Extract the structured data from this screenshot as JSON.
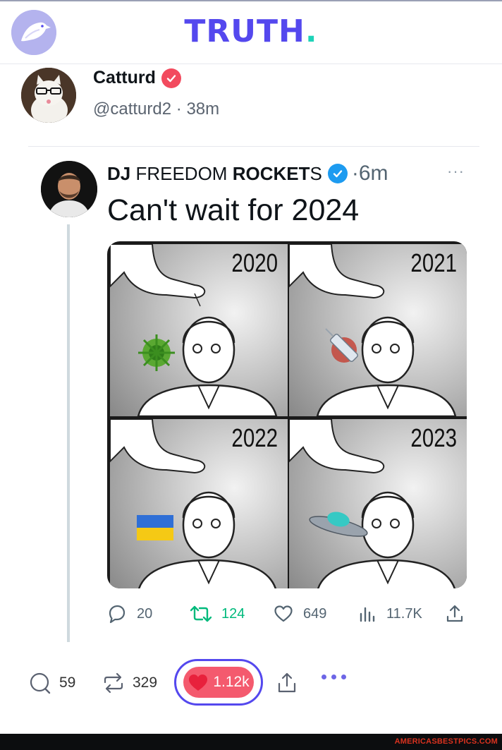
{
  "header": {
    "logo_text": "TRUTH",
    "logo_dot": ".",
    "brand_color": "#5448EE",
    "dot_color": "#1ED3B8"
  },
  "post": {
    "author_name": "Catturd",
    "verified_icon": "verified-badge-icon",
    "handle": "@catturd2",
    "separator": "·",
    "time": "38m",
    "actions": {
      "replies": "59",
      "retruths": "329",
      "likes": "1.12k"
    },
    "like_color": "#F45A6E"
  },
  "quoted": {
    "name_prefix": "DJ ",
    "name_middle": "FREEDOM ",
    "name_bold": "ROCKET",
    "name_suffix": "S",
    "separator": "·",
    "time": "6m",
    "more": "···",
    "text": "Can't wait for 2024",
    "meme_years": [
      "2020",
      "2021",
      "2022",
      "2023"
    ],
    "actions": {
      "replies": "20",
      "retweets": "124",
      "likes": "649",
      "views": "11.7K"
    },
    "verified_color": "#1D9BF0"
  },
  "footer": {
    "watermark": "AMERICASBESTPICS.COM"
  }
}
